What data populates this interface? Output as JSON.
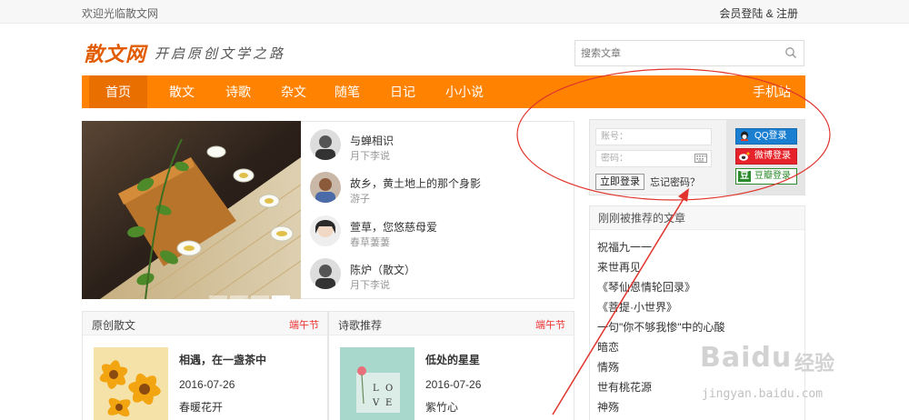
{
  "topbar": {
    "welcome": "欢迎光临散文网",
    "auth": "会员登陆 & 注册"
  },
  "header": {
    "logo": "散文网",
    "slogan": "开启原创文学之路"
  },
  "search": {
    "placeholder": "搜索文章",
    "icon": "search-icon"
  },
  "nav": {
    "items": [
      {
        "label": "首页",
        "active": true
      },
      {
        "label": "散文",
        "active": false
      },
      {
        "label": "诗歌",
        "active": false
      },
      {
        "label": "杂文",
        "active": false
      },
      {
        "label": "随笔",
        "active": false
      },
      {
        "label": "日记",
        "active": false
      },
      {
        "label": "小小说",
        "active": false
      }
    ],
    "mobile": "手机站"
  },
  "featured": [
    {
      "title": "与蝉相识",
      "author": "月下李说"
    },
    {
      "title": "故乡，黄土地上的那个身影",
      "author": "游子"
    },
    {
      "title": "萱草，您悠慈母爱",
      "author": "春草萋萋"
    },
    {
      "title": "陈炉（散文）",
      "author": "月下李说"
    }
  ],
  "login": {
    "account_placeholder": "账号：",
    "password_placeholder": "密码：",
    "submit": "立即登录",
    "forgot": "忘记密码？",
    "qq": "QQ登录",
    "weibo": "微博登录",
    "douban": "豆瓣登录",
    "douban_glyph": "豆"
  },
  "recommended": {
    "heading": "刚刚被推荐的文章",
    "items": [
      "祝福九一一",
      "来世再见",
      "《琴仙恩情轮回录》",
      "《菩提·小世界》",
      "一句\"你不够我惨\"中的心酸",
      "暗恋",
      "情殇",
      "世有桃花源",
      "神殇"
    ]
  },
  "panels": [
    {
      "name": "原创散文",
      "tag": "端午节",
      "title": "相遇，在一盏茶中",
      "date": "2016-07-26",
      "author": "春暖花开"
    },
    {
      "name": "诗歌推荐",
      "tag": "端午节",
      "title": "低处的星星",
      "date": "2016-07-26",
      "author": "紫竹心"
    }
  ],
  "watermark": {
    "brand": "Baidu",
    "cn": "经验",
    "url": "jingyan.baidu.com"
  },
  "colors": {
    "accent": "#ff8300",
    "annotation": "#e0342c",
    "logo": "#e15b00"
  }
}
